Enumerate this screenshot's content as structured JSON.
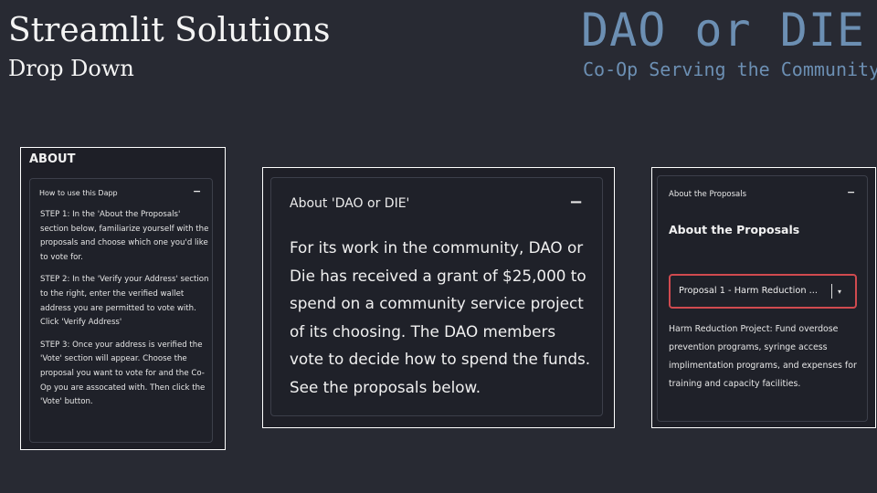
{
  "slide": {
    "title": "Streamlit Solutions",
    "subtitle": "Drop Down"
  },
  "logo": {
    "main": "DAO or DIE",
    "tagline": "Co-Op Serving the Community"
  },
  "panel1": {
    "heading": "ABOUT",
    "expander_label": "How to use this Dapp",
    "toggle": "−",
    "steps": [
      "STEP 1: In the 'About the Proposals' section below, familiarize yourself with the proposals and choose which one you'd like to vote for.",
      "STEP 2: In the 'Verify your Address' section to the right, enter the verified wallet address you are permitted to vote with. Click 'Verify Address'",
      "STEP 3: Once your address is verified the 'Vote' section will appear. Choose the proposal you want to vote for and the Co-Op you are assocated with. Then click the 'Vote' button."
    ]
  },
  "panel2": {
    "expander_label": "About 'DAO or DIE'",
    "toggle": "−",
    "body": "For its work in the community, DAO or Die has received a grant of $25,000 to spend on a community service project of its choosing. The DAO members vote to decide how to spend the funds. See the proposals below."
  },
  "panel3": {
    "expander_label": "About the Proposals",
    "toggle": "−",
    "title": "About the Proposals",
    "select_value": "Proposal 1 - Harm Reduction ...",
    "caret": "▾",
    "description": "Harm Reduction Project: Fund overdose prevention programs, syringe access implimentation programs, and expenses for training and capacity facilities."
  },
  "colors": {
    "background": "#282a33",
    "logo": "#6c8fb3",
    "select_border": "#d04a4f",
    "frame_border": "#ffffff"
  }
}
